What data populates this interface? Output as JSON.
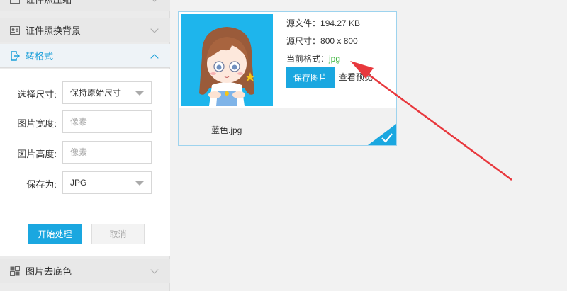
{
  "sidebar": {
    "items": [
      {
        "label": "证件照压缩",
        "icon": "id-photo-icon"
      },
      {
        "label": "证件照换背景",
        "icon": "id-card-icon"
      },
      {
        "label": "转格式",
        "icon": "convert-icon",
        "active": true
      },
      {
        "label": "图片去底色",
        "icon": "remove-bg-icon"
      }
    ],
    "form": {
      "size_label": "选择尺寸:",
      "size_value": "保持原始尺寸",
      "width_label": "图片宽度:",
      "width_placeholder": "像素",
      "height_label": "图片高度:",
      "height_placeholder": "像素",
      "save_as_label": "保存为:",
      "save_as_value": "JPG",
      "start_button": "开始处理",
      "cancel_button": "取消"
    }
  },
  "card": {
    "source_file_label": "源文件：",
    "source_file_value": "194.27 KB",
    "source_size_label": "源尺寸：",
    "source_size_value": "800 x 800",
    "current_format_label": "当前格式：",
    "current_format_value": "jpg",
    "save_button": "保存图片",
    "preview_link": "查看预览",
    "filename": "蓝色.jpg"
  },
  "colors": {
    "accent": "#1aa7e0",
    "format_green": "#3cb43c",
    "arrow": "#e8383d",
    "thumb_bg": "#1eb5ec"
  }
}
